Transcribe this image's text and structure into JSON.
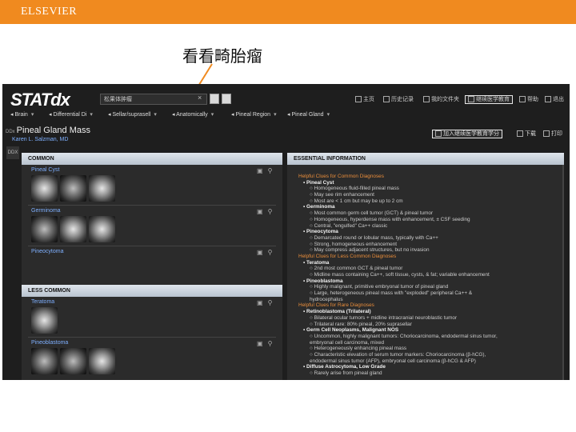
{
  "slide": {
    "brand": "ELSEVIER",
    "caption": "看看畸胎瘤"
  },
  "colors": {
    "brand_bar": "#f08a1f",
    "app_bg": "#1e1e1e",
    "link": "#7fb0ff",
    "heading_orange": "#e98d3b"
  },
  "app": {
    "logo": "STATdx",
    "search_value": "松果体肿瘤",
    "search_clear": "×",
    "toolbar_right": [
      {
        "label": "主页",
        "icon": "home-icon"
      },
      {
        "label": "历史记录",
        "icon": "history-icon"
      },
      {
        "label": "我的文件夹",
        "icon": "folder-icon"
      },
      {
        "label": "继续医学教育",
        "icon": "cme-icon",
        "highlighted": true
      },
      {
        "label": "帮助",
        "icon": "help-icon"
      },
      {
        "label": "退出",
        "icon": "logout-icon"
      }
    ],
    "breadcrumb": [
      {
        "label": "Brain"
      },
      {
        "label": "Differential Di"
      },
      {
        "label": "Sellar/suprasell"
      },
      {
        "label": "Anatomically"
      },
      {
        "label": "Pineal Region"
      },
      {
        "label": "Pineal Gland"
      }
    ],
    "doc_prefix": "DDx",
    "doc_title": "Pineal Gland Mass",
    "author": "Karen L. Salzman, MD",
    "actions_right": [
      {
        "label": "加入继续医学教育学分",
        "highlighted": true
      },
      {
        "label": "下载"
      },
      {
        "label": "打印"
      }
    ],
    "side_tab": "DDX",
    "left": {
      "sections": [
        {
          "title": "COMMON",
          "entries": [
            {
              "name": "Pineal Cyst",
              "thumbs": 3
            },
            {
              "name": "Germinoma",
              "thumbs": 3
            },
            {
              "name": "Pineocytoma",
              "thumbs": 0
            }
          ]
        },
        {
          "title": "LESS COMMON",
          "entries": [
            {
              "name": "Teratoma",
              "thumbs": 1
            },
            {
              "name": "Pineoblastoma",
              "thumbs": 3
            }
          ]
        }
      ]
    },
    "right": {
      "title": "ESSENTIAL INFORMATION",
      "lines": [
        {
          "level": "h",
          "text": "Helpful Clues for Common Diagnoses"
        },
        {
          "level": "l1",
          "text": "▪ Pineal Cyst"
        },
        {
          "level": "l2",
          "text": "○ Homogeneous fluid-filled pineal mass"
        },
        {
          "level": "l2",
          "text": "○ May see rim enhancement"
        },
        {
          "level": "l2",
          "text": "○ Most are < 1 cm but may be up to 2 cm"
        },
        {
          "level": "l1",
          "text": "▪ Germinoma"
        },
        {
          "level": "l2",
          "text": "○ Most common germ cell tumor (GCT) & pineal tumor"
        },
        {
          "level": "l2",
          "text": "○ Homogeneous, hyperdense mass with enhancement, ± CSF seeding"
        },
        {
          "level": "l2",
          "text": "○ Central, \"engulfed\" Ca++ classic"
        },
        {
          "level": "l1",
          "text": "▪ Pineocytoma"
        },
        {
          "level": "l2",
          "text": "○ Demarcated round or lobular mass, typically with Ca++"
        },
        {
          "level": "l2",
          "text": "○ Strong, homogeneous enhancement"
        },
        {
          "level": "l2",
          "text": "○ May compress adjacent structures, but no invasion"
        },
        {
          "level": "h",
          "text": "Helpful Clues for Less Common Diagnoses"
        },
        {
          "level": "l1",
          "text": "▪ Teratoma"
        },
        {
          "level": "l2",
          "text": "○ 2nd most common GCT & pineal tumor"
        },
        {
          "level": "l2",
          "text": "○ Midline mass containing Ca++, soft tissue, cysts, & fat; variable enhancement"
        },
        {
          "level": "l1",
          "text": "▪ Pineoblastoma"
        },
        {
          "level": "l2",
          "text": "○ Highly malignant, primitive embryonal tumor of pineal gland"
        },
        {
          "level": "l2",
          "text": "○ Large, heterogeneous pineal mass with \"exploded\" peripheral Ca++ &"
        },
        {
          "level": "l2",
          "text": "hydrocephalus"
        },
        {
          "level": "h",
          "text": "Helpful Clues for Rare Diagnoses"
        },
        {
          "level": "l1",
          "text": "▪ Retinoblastoma (Trilateral)"
        },
        {
          "level": "l2",
          "text": "○ Bilateral ocular tumors + midline intracranial neuroblastic tumor"
        },
        {
          "level": "l2",
          "text": "○ Trilateral rare: 80% pineal, 20% suprasellar"
        },
        {
          "level": "l1",
          "text": "▪ Germ Cell Neoplasms, Malignant NOS"
        },
        {
          "level": "l2",
          "text": "○ Uncommon, highly malignant tumors: Choriocarcinoma, endodermal sinus tumor,"
        },
        {
          "level": "l2",
          "text": "embryonal cell carcinoma, mixed"
        },
        {
          "level": "l2",
          "text": "○ Heterogeneously enhancing pineal mass"
        },
        {
          "level": "l2",
          "text": "○ Characteristic elevation of serum tumor markers: Choriocarcinoma (β-hCG),"
        },
        {
          "level": "l2",
          "text": "endodermal sinus tumor (AFP), embryonal cell carcinoma (β-hCG & AFP)"
        },
        {
          "level": "l1",
          "text": "▪ Diffuse Astrocytoma, Low Grade"
        },
        {
          "level": "l2",
          "text": "○ Rarely arise from pineal gland"
        }
      ]
    }
  }
}
